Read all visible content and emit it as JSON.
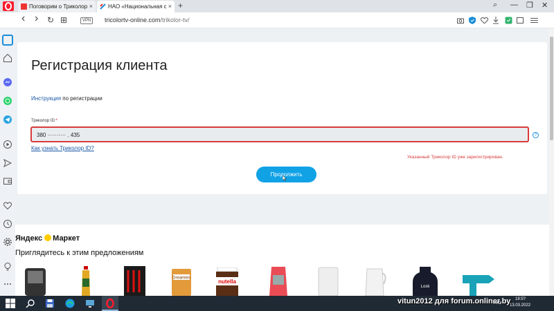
{
  "browser": {
    "tabs": [
      {
        "title": "Поговорим о Триколоре",
        "close": "×"
      },
      {
        "title": "НАО «Национальная спу",
        "close": "×"
      }
    ],
    "new_tab": "+",
    "window_controls": {
      "search": "⌕",
      "minimize": "—",
      "maximize": "❐",
      "close": "✕"
    },
    "nav": {
      "back": "‹",
      "forward": "›",
      "reload": "↻",
      "tabs": "⊞"
    },
    "vpn_label": "VPN",
    "url_host": "tricolortv-online.com",
    "url_path": "/trikolor-tv/",
    "right_icons": [
      "camera-icon",
      "shield-icon",
      "heart-icon",
      "download-icon",
      "extension-icon",
      "menu-icon"
    ]
  },
  "sidebar": {
    "items": [
      "home-icon",
      "star-icon",
      "messenger-icon",
      "whatsapp-icon",
      "telegram-icon",
      "player-icon",
      "send-icon",
      "wallet-icon",
      "heart-icon",
      "history-icon",
      "settings-icon",
      "lightbulb-icon",
      "more-icon"
    ]
  },
  "form": {
    "title": "Регистрация клиента",
    "instruction_link": "Инструкция",
    "instruction_rest": " по регистрации",
    "id_label": "Триколор ID:",
    "id_required": "*",
    "id_value": "380 ·········· . 435",
    "help": "?",
    "howto_link": "Как узнать Триколор ID?",
    "error": "Указанный Триколор ID уже зарегистрирован.",
    "continue_button": "Продолжить"
  },
  "market": {
    "logo_left": "Яндекс",
    "logo_right": "Маркет",
    "offer_heading": "Приглядитесь к этим предложениям",
    "products": [
      "shaver",
      "oil-bottle",
      "energy-drink",
      "dreamies",
      "nutella",
      "cat-food",
      "humidifier",
      "kettle",
      "detergent",
      "drill"
    ]
  },
  "taskbar": {
    "watermark": "vitun2012 для forum.onliner.by",
    "lang": "РУС",
    "time": "18:5?",
    "date": "13.03.2022"
  },
  "colors": {
    "accent": "#11a2e6",
    "error": "#d73a3a",
    "link": "#1a57a8"
  }
}
